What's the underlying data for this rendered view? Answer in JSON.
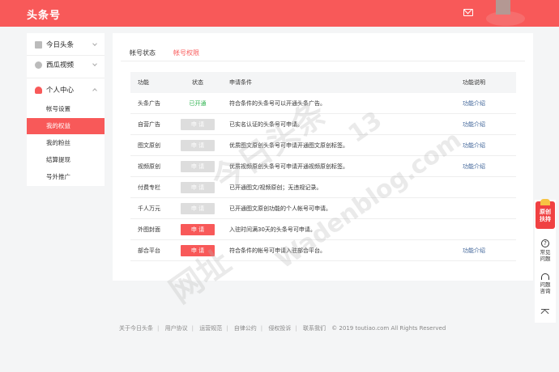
{
  "header": {
    "logo": "头条号"
  },
  "sidebar": {
    "items": [
      {
        "label": "今日头条"
      },
      {
        "label": "西瓜视频"
      },
      {
        "label": "个人中心"
      }
    ],
    "subitems": [
      {
        "label": "帐号设置"
      },
      {
        "label": "我的权益"
      },
      {
        "label": "我的粉丝"
      },
      {
        "label": "结算提现"
      },
      {
        "label": "号外推广"
      }
    ]
  },
  "tabs": [
    {
      "label": "帐号状态"
    },
    {
      "label": "帐号权限"
    }
  ],
  "table": {
    "headers": [
      "功能",
      "状态",
      "申请条件",
      "功能说明"
    ],
    "rows": [
      {
        "name": "头条广告",
        "status": "已开通",
        "condition": "符合条件的头条号可以开通头条广告。",
        "info": "功能介绍"
      },
      {
        "name": "自营广告",
        "status": "申 请",
        "condition": "已实名认证的头条号可申请。",
        "info": "功能介绍"
      },
      {
        "name": "图文原创",
        "status": "申 请",
        "condition": "优质图文原创头条号可申请开通图文原创标签。",
        "info": "功能介绍"
      },
      {
        "name": "视频原创",
        "status": "申 请",
        "condition": "优质视频原创头条号可申请开通视频原创标签。",
        "info": "功能介绍"
      },
      {
        "name": "付费专栏",
        "status": "申 请",
        "condition": "已开通图文/视频原创；无违规记录。",
        "info": ""
      },
      {
        "name": "千人万元",
        "status": "申 请",
        "condition": "已开通图文原创功能的个人帐号可申请。",
        "info": ""
      },
      {
        "name": "外图封面",
        "status": "申 请",
        "condition": "入驻时间满30天的头条号可申请。",
        "info": ""
      },
      {
        "name": "部合平台",
        "status": "申 请",
        "condition": "符合条件的帐号可申请入驻部合平台。",
        "info": "功能介绍"
      }
    ]
  },
  "float": {
    "badge": [
      "原创",
      "扶持"
    ],
    "faq": [
      "常见",
      "问题"
    ],
    "consult": [
      "问题",
      "咨询"
    ]
  },
  "footer": {
    "links": [
      "关于今日头条",
      "用户协议",
      "运营规范",
      "自律公约",
      "侵权投诉",
      "联系我们"
    ],
    "copyright": "© 2019 toutiao.com All Rights Reserved"
  },
  "watermarks": [
    "今日头条",
    "Wadenblog.com",
    "网址",
    "13"
  ],
  "colors": {
    "brand": "#f85959",
    "success": "#2bb24c",
    "link": "#406599"
  }
}
